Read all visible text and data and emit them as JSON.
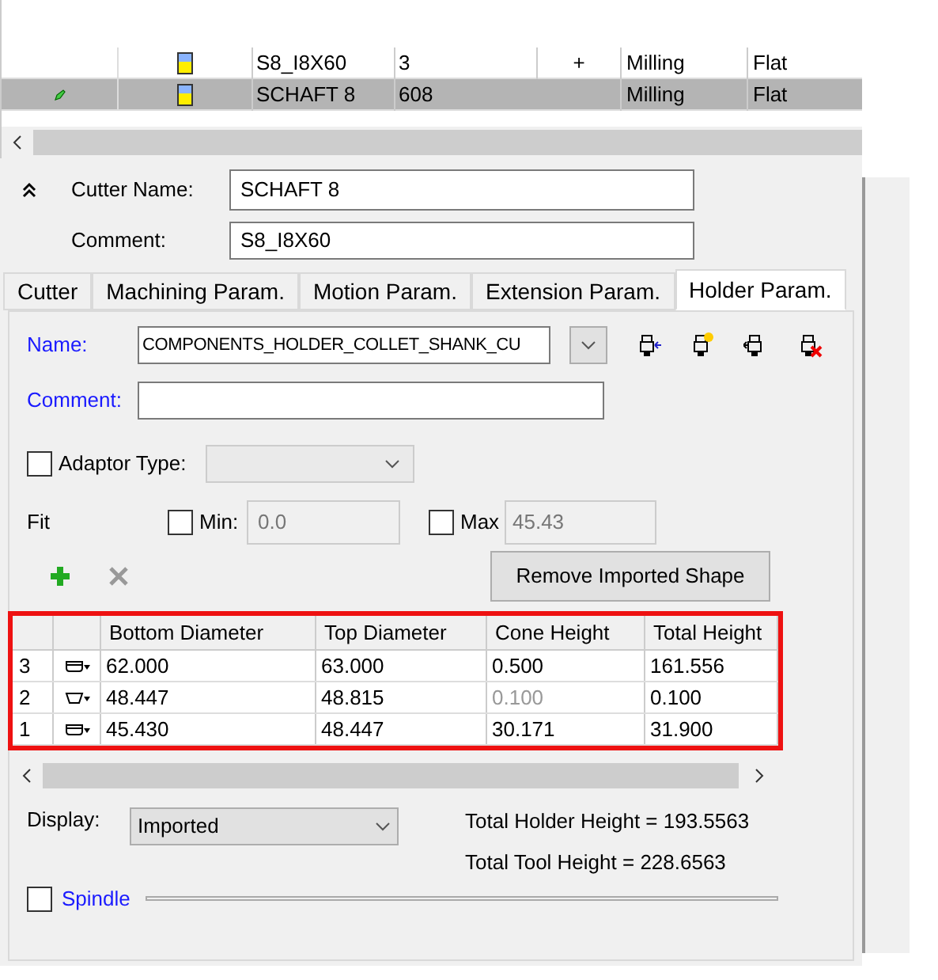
{
  "tool_list": {
    "rows": [
      {
        "name": "S8_I8X60",
        "number": "3",
        "mark": "+",
        "type": "Milling",
        "shape": "Flat",
        "selected": false
      },
      {
        "name": "SCHAFT 8",
        "number": "608",
        "mark": "",
        "type": "Milling",
        "shape": "Flat",
        "selected": true
      }
    ]
  },
  "cutter_name": {
    "label": "Cutter Name:",
    "value": "SCHAFT 8"
  },
  "comment": {
    "label": "Comment:",
    "value": "S8_I8X60"
  },
  "tabs": [
    {
      "label": "Cutter",
      "selected": false
    },
    {
      "label": "Machining Param.",
      "selected": false
    },
    {
      "label": "Motion Param.",
      "selected": false
    },
    {
      "label": "Extension Param.",
      "selected": false
    },
    {
      "label": "Holder Param.",
      "selected": true
    }
  ],
  "holder": {
    "name_label": "Name:",
    "name_value": "COMPONENTS_HOLDER_COLLET_SHANK_CU",
    "comment_label": "Comment:",
    "adaptor": {
      "label": "Adaptor Type:",
      "checked": false
    },
    "fit": {
      "label": "Fit",
      "min_label": "Min:",
      "min_checked": false,
      "min_value": "0.0",
      "max_label": "Max",
      "max_checked": false,
      "max_value": "45.43"
    },
    "remove_button": "Remove Imported Shape",
    "table": {
      "columns": [
        "Bottom Diameter",
        "Top Diameter",
        "Cone Height",
        "Total Height"
      ],
      "rows": [
        {
          "index": "3",
          "kind": "cylinder",
          "cells": [
            {
              "text": "62.000",
              "dimmed": false
            },
            {
              "text": "63.000",
              "dimmed": false
            },
            {
              "text": "0.500",
              "dimmed": false
            },
            {
              "text": "161.556",
              "dimmed": false
            }
          ]
        },
        {
          "index": "2",
          "kind": "cone",
          "cells": [
            {
              "text": "48.447",
              "dimmed": false
            },
            {
              "text": "48.815",
              "dimmed": false
            },
            {
              "text": "0.100",
              "dimmed": true
            },
            {
              "text": "0.100",
              "dimmed": false
            }
          ]
        },
        {
          "index": "1",
          "kind": "cylinder",
          "cells": [
            {
              "text": "45.430",
              "dimmed": false
            },
            {
              "text": "48.447",
              "dimmed": false
            },
            {
              "text": "30.171",
              "dimmed": false
            },
            {
              "text": "31.900",
              "dimmed": false
            }
          ]
        }
      ]
    },
    "display": {
      "label": "Display:",
      "value": "Imported"
    },
    "total_holder_height": "Total Holder Height = 193.5563",
    "total_tool_height": "Total Tool Height = 228.6563",
    "spindle": {
      "label": "Spindle",
      "checked": false
    }
  }
}
